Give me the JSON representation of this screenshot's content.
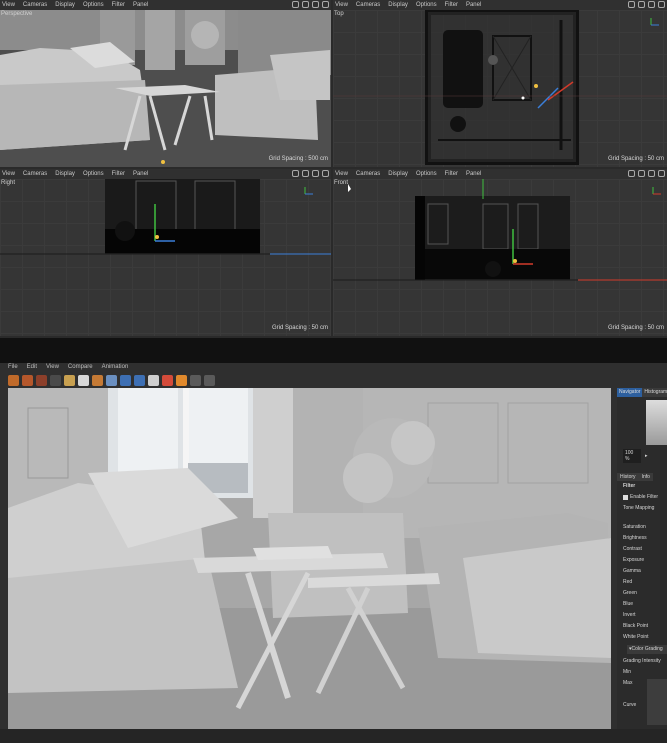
{
  "viewport_menu": [
    "View",
    "Cameras",
    "Display",
    "Options",
    "Filter",
    "Panel"
  ],
  "viewports": {
    "perspective": {
      "title": "Perspective",
      "grid_spacing": "Grid Spacing : 500 cm"
    },
    "top": {
      "title": "Top",
      "grid_spacing": "Grid Spacing : 50 cm"
    },
    "right": {
      "title": "Right",
      "grid_spacing": "Grid Spacing : 50 cm"
    },
    "front": {
      "title": "Front",
      "grid_spacing": "Grid Spacing : 50 cm"
    }
  },
  "viewer": {
    "menu": [
      "File",
      "Edit",
      "View",
      "Compare",
      "Animation"
    ],
    "toolbar_colors": [
      "#c06a2a",
      "#b5572b",
      "#8c3f2a",
      "#4a4a4a",
      "#c8a050",
      "#d8d8d8",
      "#c57a35",
      "#6a8fc0",
      "#3d6fb3",
      "#3d6fb3",
      "#cfcfcf",
      "#d44b3a",
      "#e0892c",
      "#5a5a5a",
      "#5a5a5a"
    ]
  },
  "sidebar": {
    "tabs": [
      "Navigator",
      "Histogram"
    ],
    "zoom_value": "100 %",
    "subtabs": [
      "History",
      "Info"
    ],
    "filter_heading": "Filter",
    "enable_filter": "Enable Filter",
    "items": [
      "Tone Mapping",
      "Saturation",
      "Brightness",
      "Contrast",
      "Exposure",
      "Gamma",
      "Red",
      "Green",
      "Blue",
      "Invert",
      "Black Point",
      "White Point"
    ],
    "color_grading": "Color Grading",
    "grading_items": [
      "Grading Intensity",
      "Min",
      "Max"
    ],
    "curve": "Curve"
  },
  "colors": {
    "accent": "#2d5f9e",
    "axis_red": "#d23a2a",
    "axis_green": "#3fbf3f",
    "axis_blue": "#3b7fd9",
    "highlight": "#f0c040"
  }
}
